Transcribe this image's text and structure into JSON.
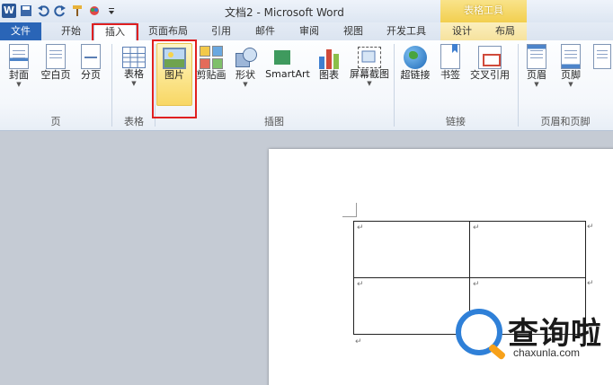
{
  "title_bar": {
    "title": "文档2 - Microsoft Word",
    "context_tab_group": "表格工具",
    "quick_access_icons": [
      "word-logo-icon",
      "save-icon",
      "undo-icon",
      "redo-icon",
      "format-painter-icon",
      "color-icon",
      "customize-icon"
    ]
  },
  "tabs": [
    {
      "label": "文件",
      "id": "file"
    },
    {
      "label": "开始",
      "id": "home"
    },
    {
      "label": "插入",
      "id": "insert",
      "active": true
    },
    {
      "label": "页面布局",
      "id": "layout"
    },
    {
      "label": "引用",
      "id": "references"
    },
    {
      "label": "邮件",
      "id": "mailings"
    },
    {
      "label": "审阅",
      "id": "review"
    },
    {
      "label": "视图",
      "id": "view"
    },
    {
      "label": "开发工具",
      "id": "developer"
    },
    {
      "label": "设计",
      "id": "design",
      "context": true
    },
    {
      "label": "布局",
      "id": "table-layout",
      "context": true
    }
  ],
  "ribbon": {
    "groups": [
      {
        "label": "页",
        "buttons": [
          "封面",
          "空白页",
          "分页"
        ]
      },
      {
        "label": "表格",
        "buttons": [
          "表格"
        ]
      },
      {
        "label": "插图",
        "buttons": [
          "图片",
          "剪贴画",
          "形状",
          "SmartArt",
          "图表",
          "屏幕截图"
        ]
      },
      {
        "label": "链接",
        "buttons": [
          "超链接",
          "书签",
          "交叉引用"
        ]
      },
      {
        "label": "页眉和页脚",
        "buttons": [
          "页眉",
          "页脚",
          ""
        ]
      }
    ],
    "highlighted_button": "图片",
    "accent_highlight": "#fbe48a",
    "annotation_color": "#e02020"
  },
  "document": {
    "table": {
      "rows": 2,
      "cols": 2,
      "cell_mark": "↵"
    },
    "end_mark": "↵"
  },
  "watermark": {
    "text": "查询啦",
    "url": "chaxunla.com",
    "logo_color": "#2f80d8"
  }
}
